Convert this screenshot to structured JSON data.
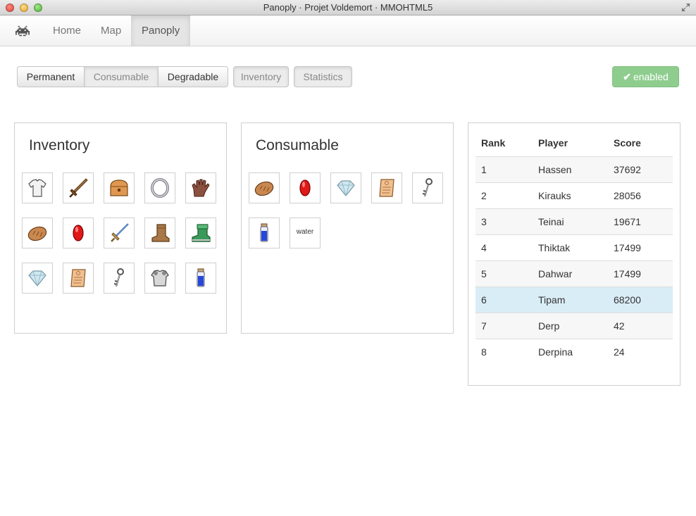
{
  "window": {
    "title": "Panoply · Projet Voldemort · MMOHTML5"
  },
  "navbar": {
    "brand_icon": "space-invader-icon",
    "items": [
      {
        "label": "Home"
      },
      {
        "label": "Map"
      },
      {
        "label": "Panoply",
        "active": true
      }
    ]
  },
  "toolbar": {
    "buttons": [
      {
        "label": "Permanent",
        "active": true
      },
      {
        "label": "Consumable",
        "active": false
      },
      {
        "label": "Degradable",
        "active": true
      },
      {
        "label": "Inventory",
        "active": false
      },
      {
        "label": "Statistics",
        "active": false
      }
    ],
    "status": {
      "icon": "check-icon",
      "label": "enabled",
      "color": "#8fcd8f"
    }
  },
  "inventory": {
    "title": "Inventory",
    "items": [
      "shirt",
      "sword",
      "chest",
      "ring",
      "glove",
      "bread",
      "ruby",
      "blue-sword",
      "boot",
      "green-boot",
      "diamond",
      "scroll",
      "key",
      "armor",
      "potion"
    ]
  },
  "consumable": {
    "title": "Consumable",
    "items": [
      "bread",
      "ruby",
      "diamond",
      "scroll",
      "key",
      "potion"
    ],
    "text_item": "water"
  },
  "scoreboard": {
    "headers": [
      "Rank",
      "Player",
      "Score"
    ],
    "rows": [
      {
        "rank": "1",
        "player": "Hassen",
        "score": "37692"
      },
      {
        "rank": "2",
        "player": "Kirauks",
        "score": "28056"
      },
      {
        "rank": "3",
        "player": "Teinai",
        "score": "19671"
      },
      {
        "rank": "4",
        "player": "Thiktak",
        "score": "17499"
      },
      {
        "rank": "5",
        "player": "Dahwar",
        "score": "17499"
      },
      {
        "rank": "6",
        "player": "Tipam",
        "score": "68200",
        "highlight": true
      },
      {
        "rank": "7",
        "player": "Derp",
        "score": "42"
      },
      {
        "rank": "8",
        "player": "Derpina",
        "score": "24"
      }
    ]
  }
}
